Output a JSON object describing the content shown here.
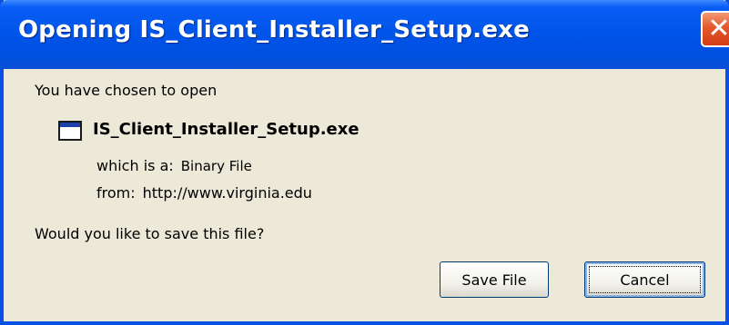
{
  "window": {
    "title": "Opening IS_Client_Installer_Setup.exe",
    "close_glyph": "✕",
    "accent_color": "#0055ea"
  },
  "dialog": {
    "intro": "You have chosen to open",
    "file_icon": "application-window-icon",
    "filename": "IS_Client_Installer_Setup.exe",
    "type_label": "which is a:",
    "type_value": "Binary File",
    "from_label": "from:",
    "from_value": "http://www.virginia.edu",
    "question": "Would you like to save this file?"
  },
  "buttons": {
    "save": "Save File",
    "cancel": "Cancel"
  }
}
